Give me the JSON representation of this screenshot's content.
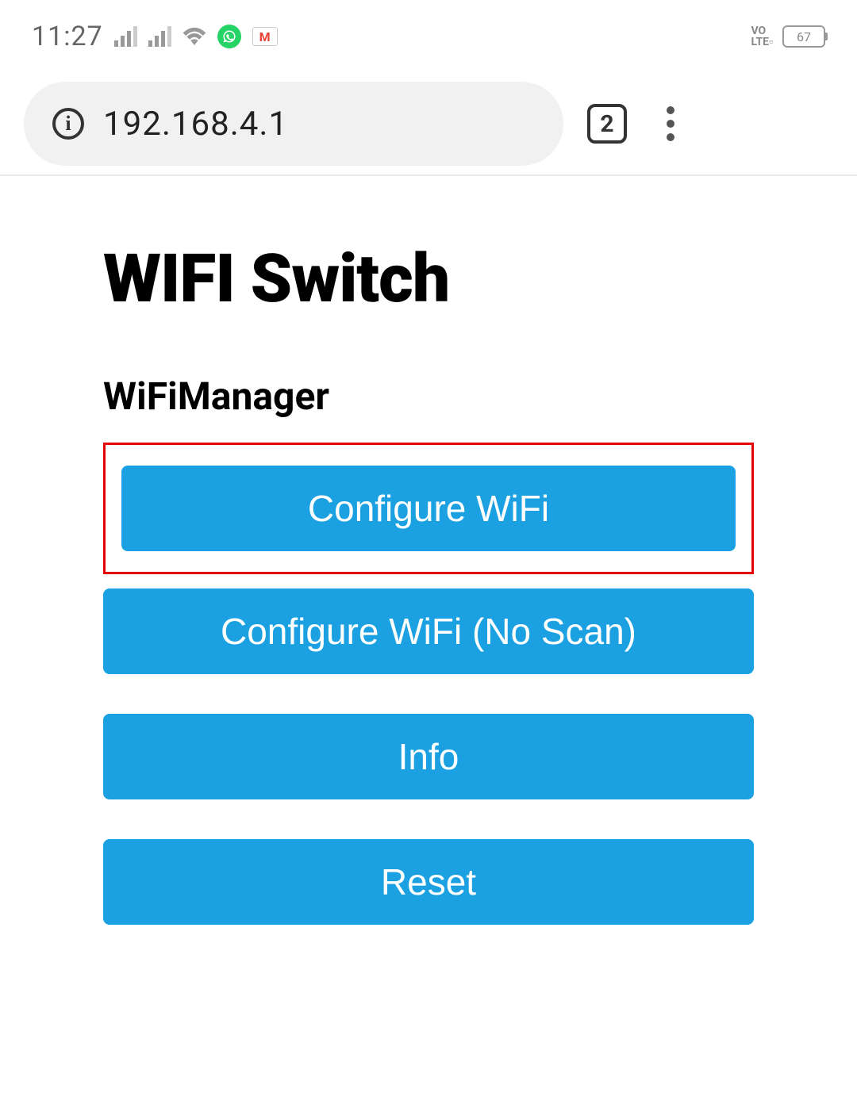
{
  "status": {
    "time": "11:27",
    "battery_level": "67",
    "network_label": "VO\nLTE"
  },
  "browser": {
    "url": "192.168.4.1",
    "tab_count": "2"
  },
  "page": {
    "title": "WIFI Switch",
    "section": "WiFiManager",
    "buttons": {
      "configure_wifi": "Configure WiFi",
      "configure_wifi_noscan": "Configure WiFi (No Scan)",
      "info": "Info",
      "reset": "Reset"
    }
  }
}
